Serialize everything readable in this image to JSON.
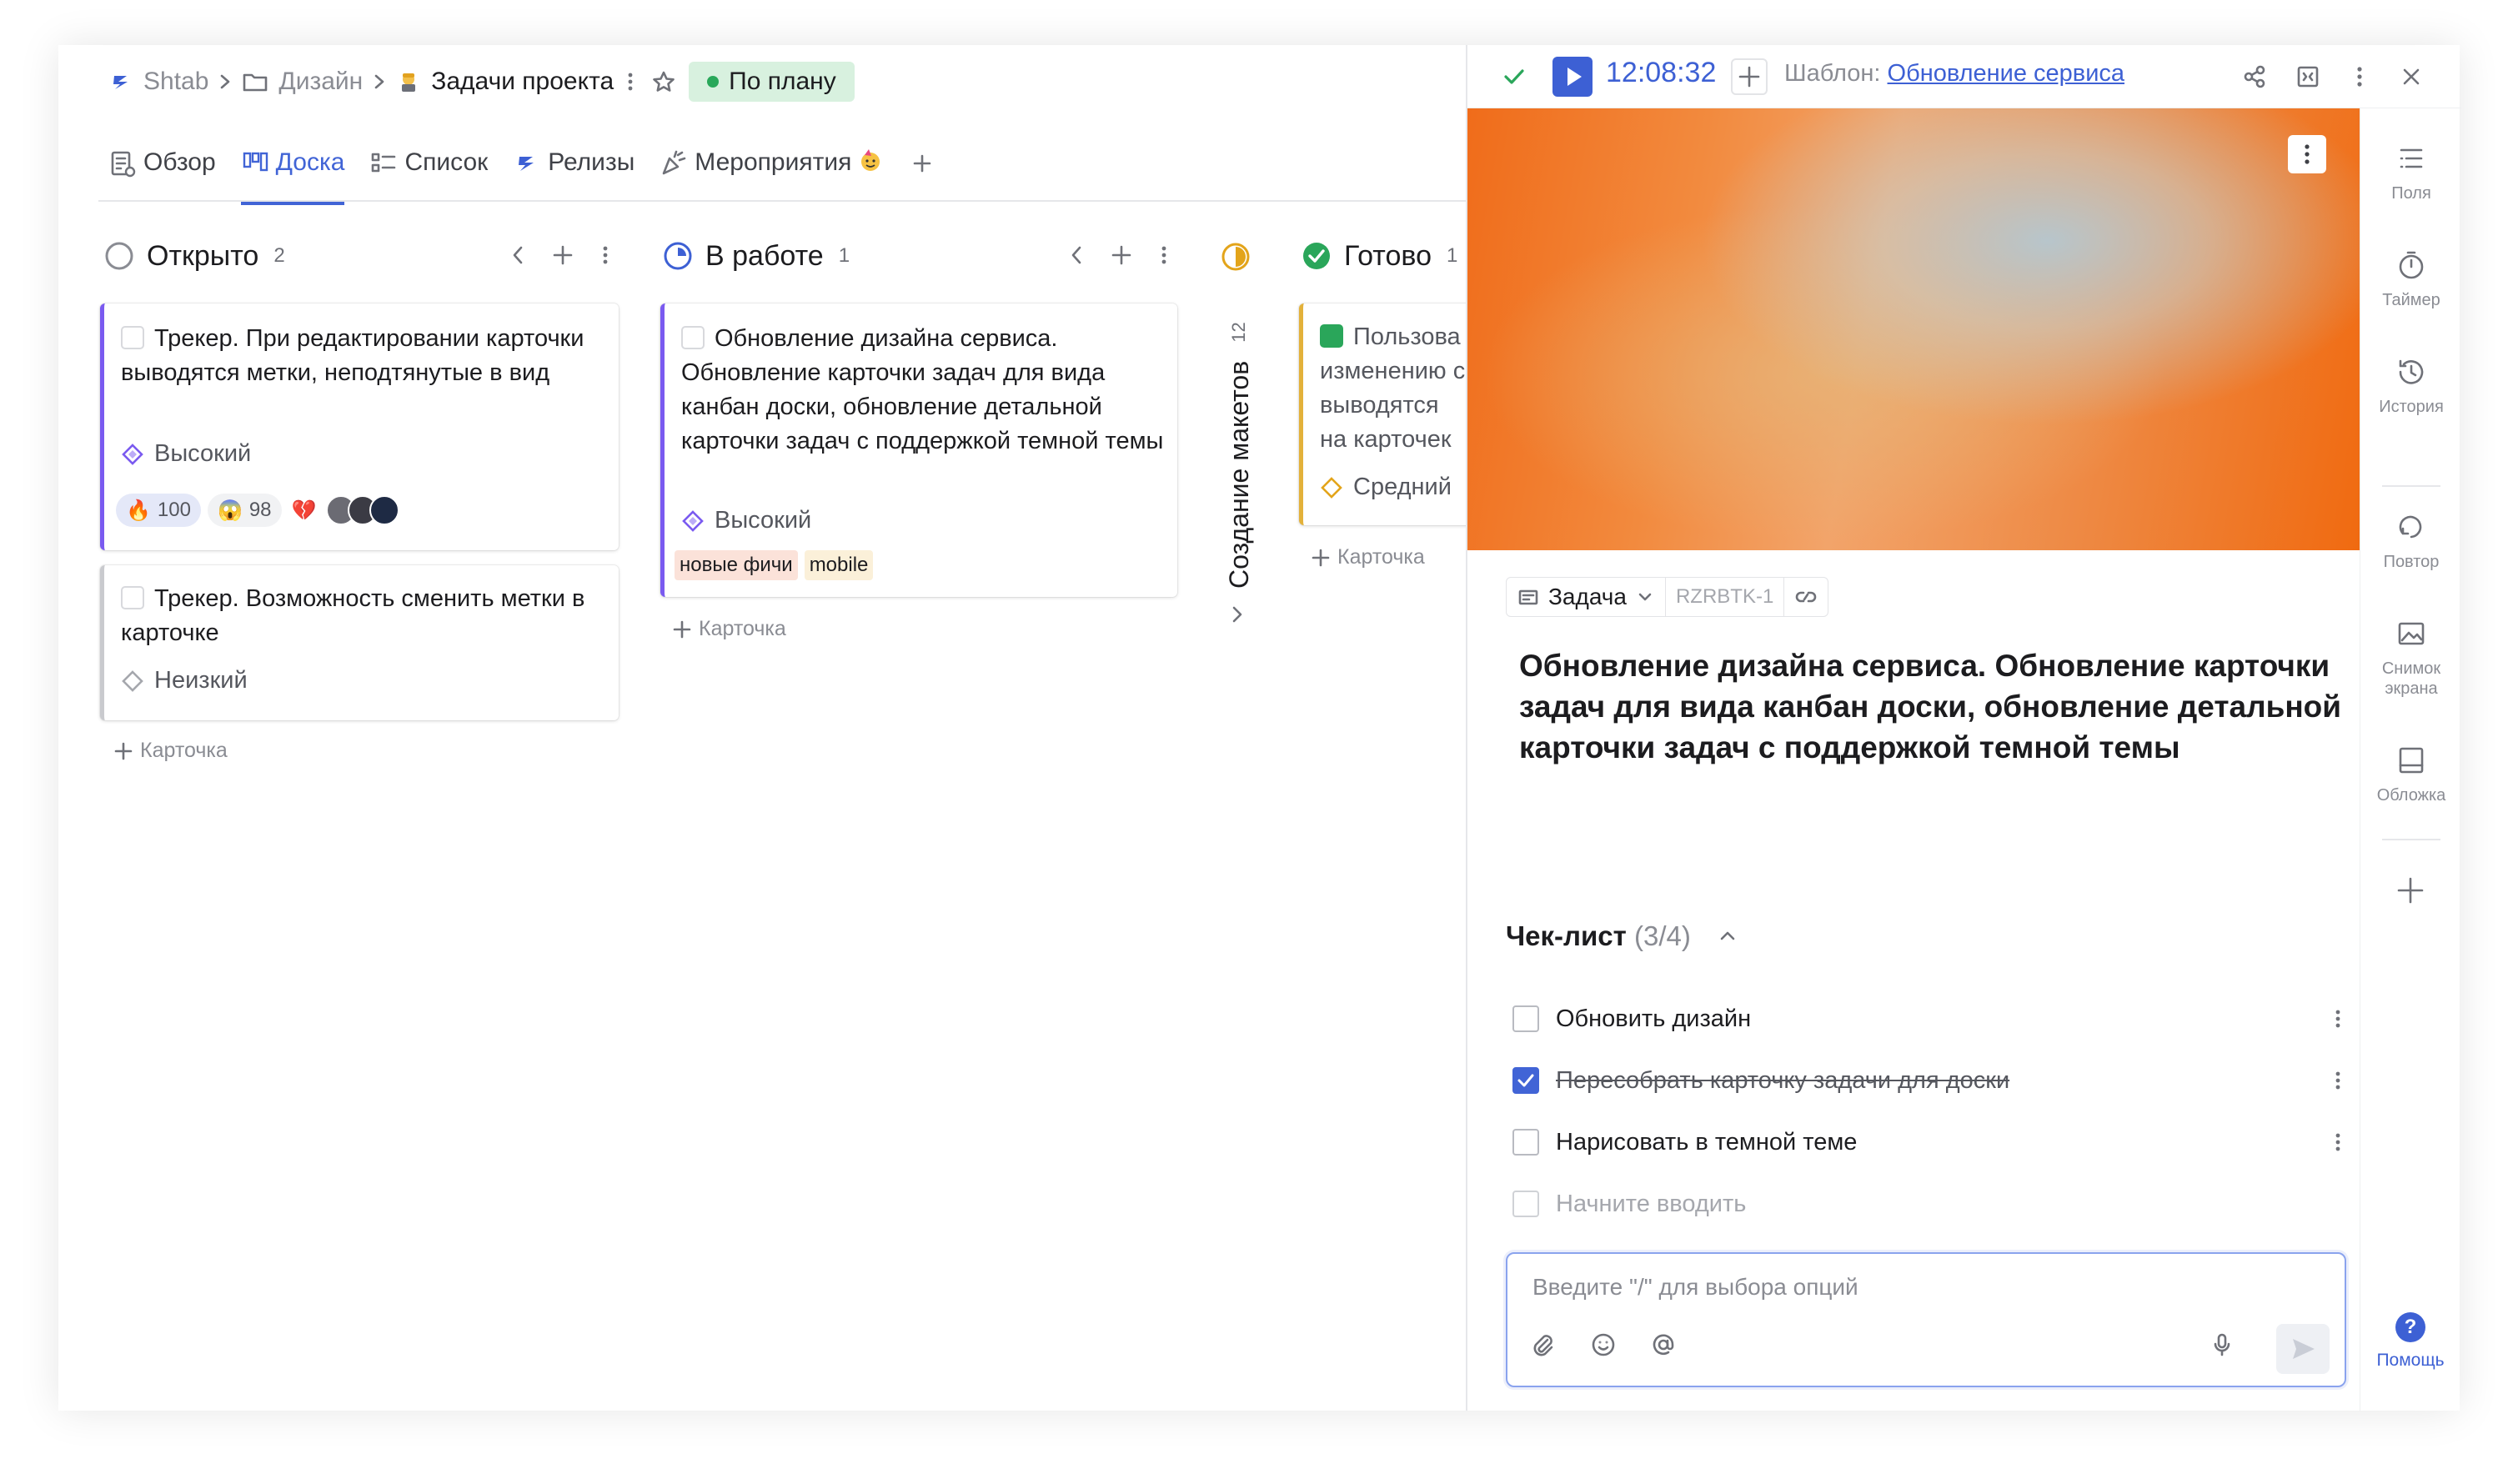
{
  "breadcrumb": {
    "workspace": "Shtab",
    "folder": "Дизайн",
    "project": "Задачи проекта",
    "status": "По плану",
    "status_color": "#29a85a"
  },
  "tabs": [
    {
      "label": "Обзор",
      "icon": "overview-icon"
    },
    {
      "label": "Доска",
      "icon": "board-icon",
      "active": true
    },
    {
      "label": "Список",
      "icon": "list-icon"
    },
    {
      "label": "Релизы",
      "icon": "releases-icon"
    },
    {
      "label": "Мероприятия",
      "icon": "events-icon"
    }
  ],
  "columns": [
    {
      "title": "Открыто",
      "count": "2",
      "cards": [
        {
          "title": "Трекер. При редактировании карточки выводятся метки, неподтянутые в вид",
          "priority": "Высокий",
          "reactions": [
            {
              "emoji": "🔥",
              "count": "100"
            },
            {
              "emoji": "😱",
              "count": "98"
            },
            {
              "emoji": "💔",
              "count": ""
            }
          ]
        },
        {
          "title": "Трекер. Возможность сменить метки в карточке",
          "priority": "Неизкий"
        }
      ],
      "add_label": "Карточка"
    },
    {
      "title": "В работе",
      "count": "1",
      "cards": [
        {
          "title": "Обновление дизайна сервиса. Обновление карточки задач для вида канбан доски, обновление детальной карточки задач  с поддержкой темной темы",
          "priority": "Высокий",
          "tags": [
            "новые фичи",
            "mobile"
          ]
        }
      ],
      "add_label": "Карточка"
    },
    {
      "title": "Создание макетов",
      "count": "12",
      "collapsed": true
    },
    {
      "title": "Готово",
      "count": "1",
      "cards": [
        {
          "title": "Пользова изменению с выводятся на карточек",
          "priority": "Средний"
        }
      ],
      "add_label": "Карточка"
    }
  ],
  "panel": {
    "timer": "12:08:32",
    "template_label": "Шаблон:",
    "template_name": "Обновление сервиса",
    "task_type": "Задача",
    "task_id": "RZRBTK-1",
    "title": "Обновление дизайна сервиса. Обновление карточки задач для вида канбан доски, обновление детальной карточки задач  с поддержкой темной темы",
    "checklist_title": "Чек-лист",
    "checklist_progress": "(3/4)",
    "checklist": [
      {
        "text": "Обновить дизайн",
        "done": false
      },
      {
        "text": "Пересобрать карточку задачи для доски",
        "done": true
      },
      {
        "text": "Нарисовать в темной теме",
        "done": false
      }
    ],
    "new_item_placeholder": "Начните вводить",
    "composer_placeholder": "Введите \"/\" для выбора опций",
    "rail": [
      {
        "label": "Поля",
        "icon": "fields-icon"
      },
      {
        "label": "Таймер",
        "icon": "timer-icon"
      },
      {
        "label": "История",
        "icon": "history-icon"
      },
      {
        "label": "Повтор",
        "icon": "repeat-icon"
      },
      {
        "label": "Снимок экрана",
        "icon": "screenshot-icon"
      },
      {
        "label": "Обложка",
        "icon": "cover-icon"
      }
    ],
    "help_label": "Помощь"
  },
  "colors": {
    "accent": "#4164d6",
    "priority_high": "#7a5af0",
    "card_border_done": "#e3b13a",
    "cover_orange": "#f06c1a"
  }
}
